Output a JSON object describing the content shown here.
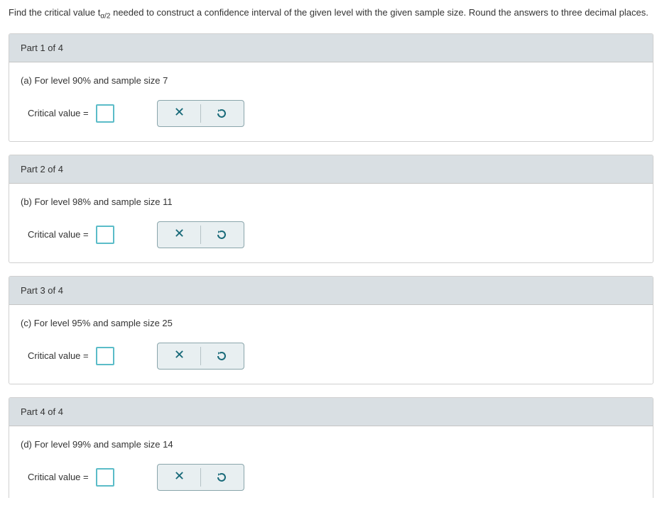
{
  "instructions": {
    "prefix": "Find the critical value ",
    "symbol": "t",
    "subscript": "α/2",
    "suffix": " needed to construct a confidence interval of the given level with the given sample size. Round the answers to three decimal places."
  },
  "parts": [
    {
      "header": "Part 1 of 4",
      "question": "(a) For level 90% and sample size 7",
      "label": "Critical value ="
    },
    {
      "header": "Part 2 of 4",
      "question": "(b) For level 98% and sample size 11",
      "label": "Critical value ="
    },
    {
      "header": "Part 3 of 4",
      "question": "(c) For level 95% and sample size 25",
      "label": "Critical value ="
    },
    {
      "header": "Part 4 of 4",
      "question": "(d) For level 99% and sample size 14",
      "label": "Critical value ="
    }
  ]
}
